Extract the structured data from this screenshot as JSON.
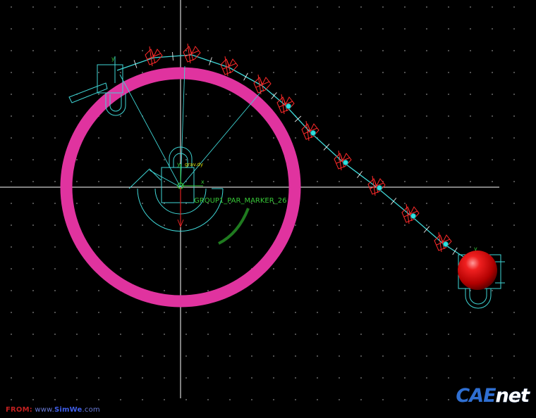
{
  "scene": {
    "background": "#000000",
    "grid_color": "#8a8a8a",
    "axis_color": "#ffffff",
    "wheel_color": "#e0339f",
    "ball_color": "#d80c0c",
    "link_color": "#3fd6d6",
    "force_color": "#ff2a2a",
    "marker_label_color": "#37c837"
  },
  "labels": {
    "marker_name": "GROUP1_PAR_MARKER_26",
    "axis_x": "x",
    "axis_y": "y",
    "gravity_tag": "grav.dy"
  },
  "watermark": {
    "from_label": "FROM:",
    "from_url_prefix": "www.",
    "from_url_name": "SimWe",
    "from_url_suffix": ".com",
    "logo_cae": "CAE",
    "logo_net": "net"
  }
}
